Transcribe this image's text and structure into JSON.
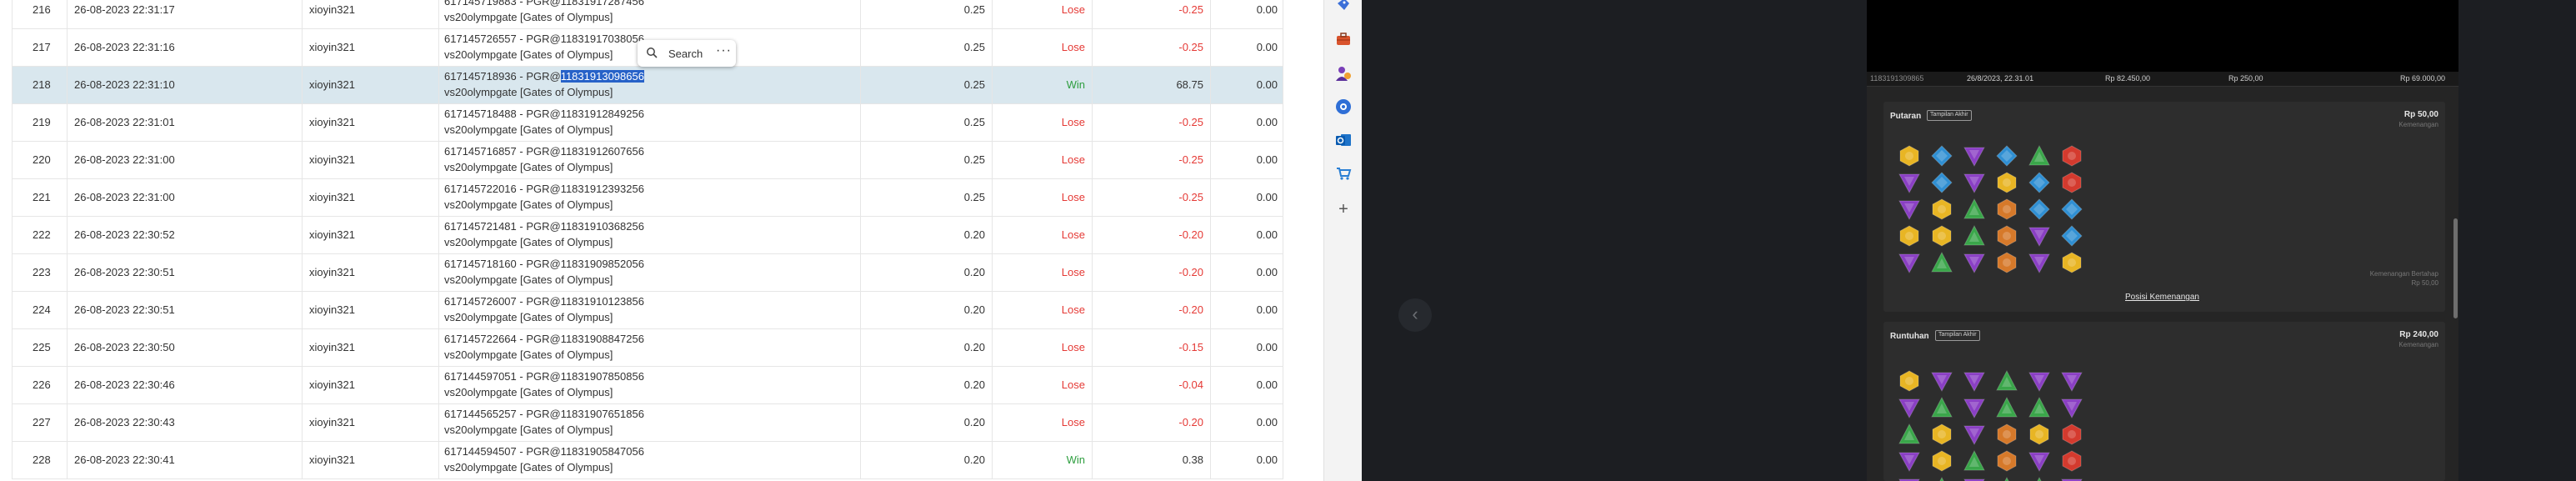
{
  "table": {
    "rows": [
      {
        "no": "216",
        "date": "26-08-2023 22:31:17",
        "user": "xioyin321",
        "desc1": "617145719883 - PGR@11831917287456",
        "desc2": "vs20olympgate [Gates of Olympus]",
        "bet": "0.25",
        "result": "Lose",
        "win": "-0.25",
        "balance": "0.00"
      },
      {
        "no": "217",
        "date": "26-08-2023 22:31:16",
        "user": "xioyin321",
        "desc1": "617145726557 - PGR@11831917038056",
        "desc2": "vs20olympgate [Gates of Olympus]",
        "bet": "0.25",
        "result": "Lose",
        "win": "-0.25",
        "balance": "0.00"
      },
      {
        "no": "218",
        "date": "26-08-2023 22:31:10",
        "user": "xioyin321",
        "desc1_pre": "617145718936 - PGR@",
        "desc1_hl": "11831913098656",
        "desc2": "vs20olympgate [Gates of Olympus]",
        "bet": "0.25",
        "result": "Win",
        "win": "68.75",
        "balance": "0.00"
      },
      {
        "no": "219",
        "date": "26-08-2023 22:31:01",
        "user": "xioyin321",
        "desc1": "617145718488 - PGR@11831912849256",
        "desc2": "vs20olympgate [Gates of Olympus]",
        "bet": "0.25",
        "result": "Lose",
        "win": "-0.25",
        "balance": "0.00"
      },
      {
        "no": "220",
        "date": "26-08-2023 22:31:00",
        "user": "xioyin321",
        "desc1": "617145716857 - PGR@11831912607656",
        "desc2": "vs20olympgate [Gates of Olympus]",
        "bet": "0.25",
        "result": "Lose",
        "win": "-0.25",
        "balance": "0.00"
      },
      {
        "no": "221",
        "date": "26-08-2023 22:31:00",
        "user": "xioyin321",
        "desc1": "617145722016 - PGR@11831912393256",
        "desc2": "vs20olympgate [Gates of Olympus]",
        "bet": "0.25",
        "result": "Lose",
        "win": "-0.25",
        "balance": "0.00"
      },
      {
        "no": "222",
        "date": "26-08-2023 22:30:52",
        "user": "xioyin321",
        "desc1": "617145721481 - PGR@11831910368256",
        "desc2": "vs20olympgate [Gates of Olympus]",
        "bet": "0.20",
        "result": "Lose",
        "win": "-0.20",
        "balance": "0.00"
      },
      {
        "no": "223",
        "date": "26-08-2023 22:30:51",
        "user": "xioyin321",
        "desc1": "617145718160 - PGR@11831909852056",
        "desc2": "vs20olympgate [Gates of Olympus]",
        "bet": "0.20",
        "result": "Lose",
        "win": "-0.20",
        "balance": "0.00"
      },
      {
        "no": "224",
        "date": "26-08-2023 22:30:51",
        "user": "xioyin321",
        "desc1": "617145726007 - PGR@11831910123856",
        "desc2": "vs20olympgate [Gates of Olympus]",
        "bet": "0.20",
        "result": "Lose",
        "win": "-0.20",
        "balance": "0.00"
      },
      {
        "no": "225",
        "date": "26-08-2023 22:30:50",
        "user": "xioyin321",
        "desc1": "617145722664 - PGR@11831908847256",
        "desc2": "vs20olympgate [Gates of Olympus]",
        "bet": "0.20",
        "result": "Lose",
        "win": "-0.15",
        "balance": "0.00"
      },
      {
        "no": "226",
        "date": "26-08-2023 22:30:46",
        "user": "xioyin321",
        "desc1": "617144597051 - PGR@11831907850856",
        "desc2": "vs20olympgate [Gates of Olympus]",
        "bet": "0.20",
        "result": "Lose",
        "win": "-0.04",
        "balance": "0.00"
      },
      {
        "no": "227",
        "date": "26-08-2023 22:30:43",
        "user": "xioyin321",
        "desc1": "617144565257 - PGR@11831907651856",
        "desc2": "vs20olympgate [Gates of Olympus]",
        "bet": "0.20",
        "result": "Lose",
        "win": "-0.20",
        "balance": "0.00"
      },
      {
        "no": "228",
        "date": "26-08-2023 22:30:41",
        "user": "xioyin321",
        "desc1": "617144594507 - PGR@11831905847056",
        "desc2": "vs20olympgate [Gates of Olympus]",
        "bet": "0.20",
        "result": "Win",
        "win": "0.38",
        "balance": "0.00"
      }
    ]
  },
  "popup": {
    "search_label": "Search",
    "more_label": "···"
  },
  "sidebar": {
    "add_label": "+"
  },
  "nav": {
    "prev_arrow": "‹"
  },
  "game": {
    "info": {
      "round_id": "1183191309865",
      "date": "26/8/2023, 22.31.01",
      "bet": "Rp 82.450,00",
      "stake": "Rp 250,00",
      "win": "Rp 69.000,00"
    },
    "spin": {
      "title": "Putaran",
      "badge": "Tampilan Akhir",
      "amount": "Rp 50,00",
      "amount_sub": "Kemenangan",
      "win_label": "Kemenangan Bertahap",
      "win_amount": "Rp 50,00",
      "link": "Posisi Kemenangan"
    },
    "cascade": {
      "title": "Runtuhan",
      "badge": "Tampilan Akhir",
      "amount": "Rp 240,00",
      "amount_sub": "Kemenangan"
    },
    "grid_spin": [
      [
        "yellow",
        "blue",
        "purple",
        "blue",
        "green",
        "red"
      ],
      [
        "purple",
        "blue",
        "purple",
        "yellow",
        "blue",
        "red"
      ],
      [
        "purple",
        "yellow",
        "green",
        "orange",
        "blue",
        "blue"
      ],
      [
        "yellow",
        "yellow",
        "green",
        "orange",
        "purple",
        "blue"
      ],
      [
        "purple",
        "green",
        "purple",
        "orange",
        "purple",
        "yellow"
      ]
    ],
    "grid_cascade": [
      [
        "yellow",
        "purple",
        "purple",
        "green",
        "purple",
        "purple"
      ],
      [
        "purple",
        "green",
        "purple",
        "green",
        "green",
        "purple"
      ],
      [
        "green",
        "yellow",
        "purple",
        "orange",
        "yellow",
        "red"
      ],
      [
        "purple",
        "yellow",
        "green",
        "orange",
        "purple",
        "red"
      ],
      [
        "purple",
        "green",
        "purple",
        "green",
        "green",
        "purple"
      ]
    ],
    "gem_colors": {
      "yellow": "#e8b524",
      "blue": "#2f8fd3",
      "purple": "#8a3fc4",
      "green": "#3aa64a",
      "red": "#d43a2e",
      "orange": "#d6792a"
    }
  },
  "colors": {
    "lose": "#e53935",
    "win": "#2e9e3f",
    "highlight": "#2762c8",
    "selected_row": "#d9e7ee"
  }
}
